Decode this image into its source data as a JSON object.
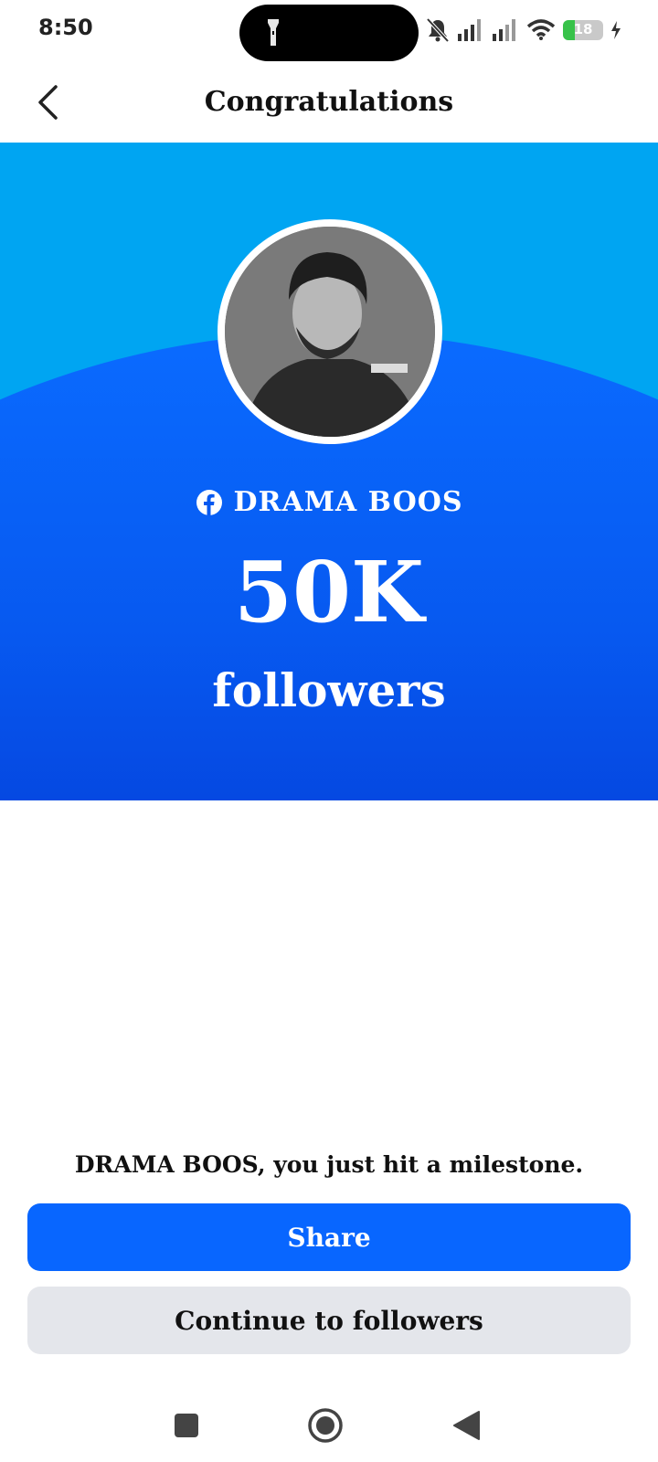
{
  "status_bar": {
    "time": "8:50",
    "battery_level": "18",
    "battery_fraction": 0.18,
    "icons": [
      "flashlight-icon",
      "bell-muted-icon",
      "signal-icon",
      "signal-icon",
      "wifi-icon",
      "battery-icon",
      "charging-icon"
    ]
  },
  "header": {
    "title": "Congratulations",
    "back_icon": "chevron-left-icon"
  },
  "hero": {
    "colors": {
      "top": "#00a5f2",
      "arc_top": "#0a6bff",
      "arc_bottom": "#0012b0"
    },
    "profile_name": "DRAMA BOOS",
    "profile_icon": "facebook-icon",
    "milestone_count": "50K",
    "milestone_unit": "followers"
  },
  "footer": {
    "message": "DRAMA BOOS, you just hit a milestone.",
    "share_label": "Share",
    "continue_label": "Continue to followers",
    "accent": "#0866ff"
  },
  "nav": {
    "icons": [
      "square-icon",
      "home-circle-icon",
      "back-triangle-icon"
    ]
  }
}
